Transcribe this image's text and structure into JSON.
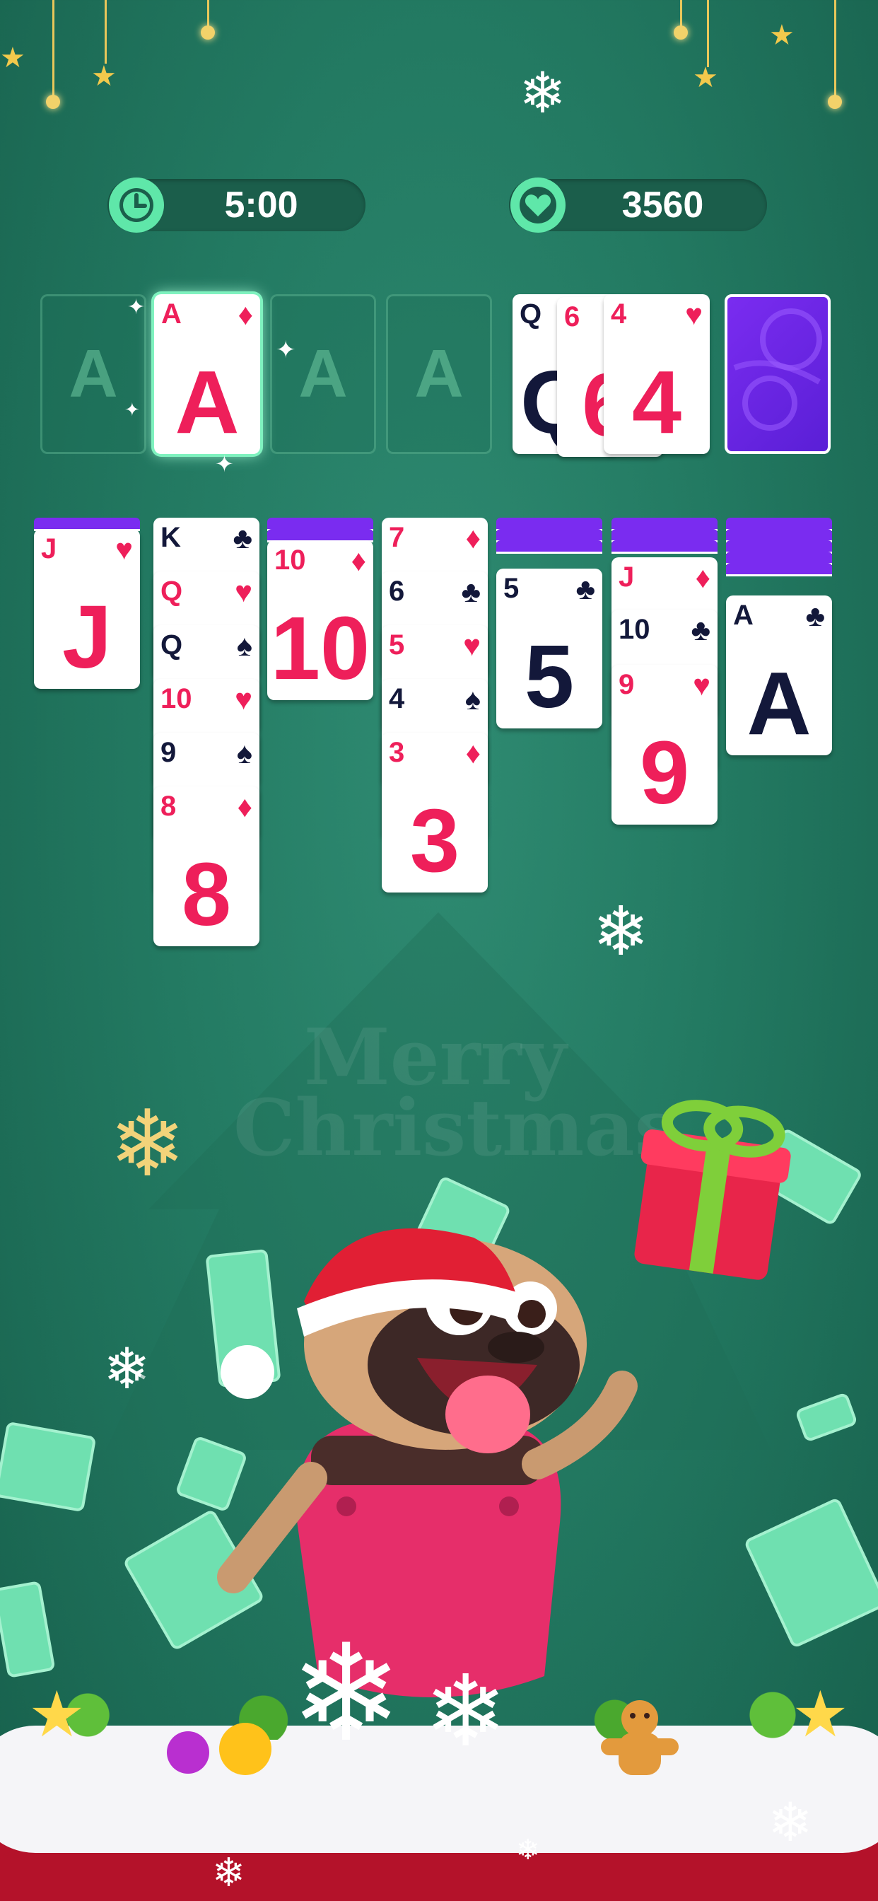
{
  "timer": {
    "value": "5:00",
    "icon": "clock-icon"
  },
  "score": {
    "value": "3560",
    "icon": "heart-icon"
  },
  "foundation": [
    {
      "label": "A",
      "filled": false
    },
    {
      "rank": "A",
      "suit": "♦",
      "color": "red",
      "filled": true
    },
    {
      "label": "A",
      "filled": false
    },
    {
      "label": "A",
      "filled": false
    }
  ],
  "waste": [
    {
      "rank": "Q",
      "suit": "",
      "color": "black"
    },
    {
      "rank": "6",
      "suit": "",
      "color": "red"
    },
    {
      "rank": "4",
      "suit": "♥",
      "color": "red"
    }
  ],
  "stock": {
    "type": "face-down"
  },
  "tableau": [
    {
      "hidden": 1,
      "cards": [
        {
          "rank": "J",
          "suit": "♥",
          "color": "red"
        }
      ]
    },
    {
      "hidden": 0,
      "cards": [
        {
          "rank": "K",
          "suit": "♣",
          "color": "black"
        },
        {
          "rank": "Q",
          "suit": "♥",
          "color": "red"
        },
        {
          "rank": "Q",
          "suit": "♠",
          "color": "black"
        },
        {
          "rank": "10",
          "suit": "♥",
          "color": "red"
        },
        {
          "rank": "9",
          "suit": "♠",
          "color": "black"
        },
        {
          "rank": "8",
          "suit": "♦",
          "color": "red"
        }
      ]
    },
    {
      "hidden": 2,
      "cards": [
        {
          "rank": "10",
          "suit": "♦",
          "color": "red"
        }
      ]
    },
    {
      "hidden": 0,
      "cards": [
        {
          "rank": "7",
          "suit": "♦",
          "color": "red"
        },
        {
          "rank": "6",
          "suit": "♣",
          "color": "black"
        },
        {
          "rank": "5",
          "suit": "♥",
          "color": "red"
        },
        {
          "rank": "4",
          "suit": "♠",
          "color": "black"
        },
        {
          "rank": "3",
          "suit": "♦",
          "color": "red"
        }
      ]
    },
    {
      "hidden": 3,
      "cards": [
        {
          "rank": "5",
          "suit": "♣",
          "color": "black"
        }
      ]
    },
    {
      "hidden": 3,
      "cards": [
        {
          "rank": "J",
          "suit": "♦",
          "color": "red"
        },
        {
          "rank": "10",
          "suit": "♣",
          "color": "black"
        },
        {
          "rank": "9",
          "suit": "♥",
          "color": "red"
        }
      ]
    },
    {
      "hidden": 5,
      "cards": [
        {
          "rank": "A",
          "suit": "♣",
          "color": "black"
        }
      ]
    }
  ],
  "background": {
    "text_line1": "Merry",
    "text_line2": "Christmas"
  },
  "colors": {
    "red": "#ee1f5a",
    "black": "#13183a",
    "card_back": "#7a2cf0",
    "accent": "#5fe7a9"
  }
}
